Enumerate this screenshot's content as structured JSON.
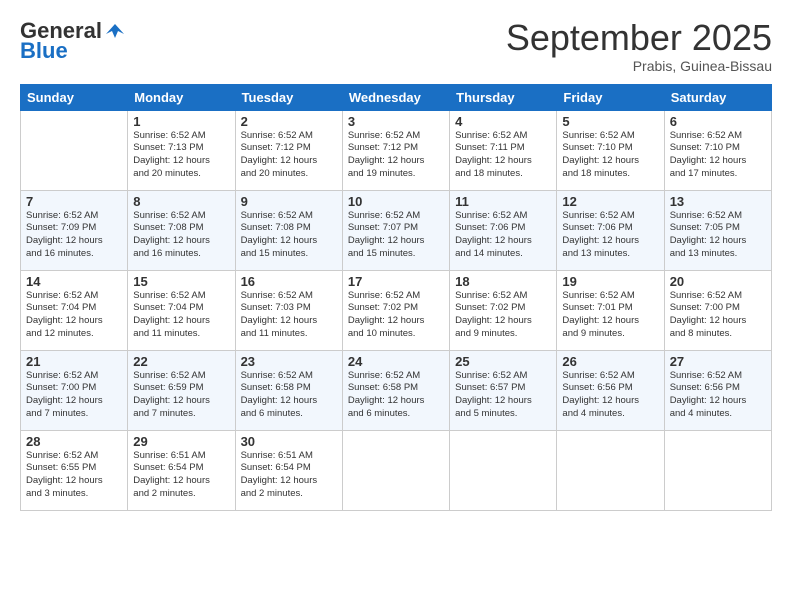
{
  "header": {
    "logo_general": "General",
    "logo_blue": "Blue",
    "month": "September 2025",
    "location": "Prabis, Guinea-Bissau"
  },
  "columns": [
    "Sunday",
    "Monday",
    "Tuesday",
    "Wednesday",
    "Thursday",
    "Friday",
    "Saturday"
  ],
  "weeks": [
    [
      {
        "day": "",
        "info": ""
      },
      {
        "day": "1",
        "info": "Sunrise: 6:52 AM\nSunset: 7:13 PM\nDaylight: 12 hours\nand 20 minutes."
      },
      {
        "day": "2",
        "info": "Sunrise: 6:52 AM\nSunset: 7:12 PM\nDaylight: 12 hours\nand 20 minutes."
      },
      {
        "day": "3",
        "info": "Sunrise: 6:52 AM\nSunset: 7:12 PM\nDaylight: 12 hours\nand 19 minutes."
      },
      {
        "day": "4",
        "info": "Sunrise: 6:52 AM\nSunset: 7:11 PM\nDaylight: 12 hours\nand 18 minutes."
      },
      {
        "day": "5",
        "info": "Sunrise: 6:52 AM\nSunset: 7:10 PM\nDaylight: 12 hours\nand 18 minutes."
      },
      {
        "day": "6",
        "info": "Sunrise: 6:52 AM\nSunset: 7:10 PM\nDaylight: 12 hours\nand 17 minutes."
      }
    ],
    [
      {
        "day": "7",
        "info": "Sunrise: 6:52 AM\nSunset: 7:09 PM\nDaylight: 12 hours\nand 16 minutes."
      },
      {
        "day": "8",
        "info": "Sunrise: 6:52 AM\nSunset: 7:08 PM\nDaylight: 12 hours\nand 16 minutes."
      },
      {
        "day": "9",
        "info": "Sunrise: 6:52 AM\nSunset: 7:08 PM\nDaylight: 12 hours\nand 15 minutes."
      },
      {
        "day": "10",
        "info": "Sunrise: 6:52 AM\nSunset: 7:07 PM\nDaylight: 12 hours\nand 15 minutes."
      },
      {
        "day": "11",
        "info": "Sunrise: 6:52 AM\nSunset: 7:06 PM\nDaylight: 12 hours\nand 14 minutes."
      },
      {
        "day": "12",
        "info": "Sunrise: 6:52 AM\nSunset: 7:06 PM\nDaylight: 12 hours\nand 13 minutes."
      },
      {
        "day": "13",
        "info": "Sunrise: 6:52 AM\nSunset: 7:05 PM\nDaylight: 12 hours\nand 13 minutes."
      }
    ],
    [
      {
        "day": "14",
        "info": "Sunrise: 6:52 AM\nSunset: 7:04 PM\nDaylight: 12 hours\nand 12 minutes."
      },
      {
        "day": "15",
        "info": "Sunrise: 6:52 AM\nSunset: 7:04 PM\nDaylight: 12 hours\nand 11 minutes."
      },
      {
        "day": "16",
        "info": "Sunrise: 6:52 AM\nSunset: 7:03 PM\nDaylight: 12 hours\nand 11 minutes."
      },
      {
        "day": "17",
        "info": "Sunrise: 6:52 AM\nSunset: 7:02 PM\nDaylight: 12 hours\nand 10 minutes."
      },
      {
        "day": "18",
        "info": "Sunrise: 6:52 AM\nSunset: 7:02 PM\nDaylight: 12 hours\nand 9 minutes."
      },
      {
        "day": "19",
        "info": "Sunrise: 6:52 AM\nSunset: 7:01 PM\nDaylight: 12 hours\nand 9 minutes."
      },
      {
        "day": "20",
        "info": "Sunrise: 6:52 AM\nSunset: 7:00 PM\nDaylight: 12 hours\nand 8 minutes."
      }
    ],
    [
      {
        "day": "21",
        "info": "Sunrise: 6:52 AM\nSunset: 7:00 PM\nDaylight: 12 hours\nand 7 minutes."
      },
      {
        "day": "22",
        "info": "Sunrise: 6:52 AM\nSunset: 6:59 PM\nDaylight: 12 hours\nand 7 minutes."
      },
      {
        "day": "23",
        "info": "Sunrise: 6:52 AM\nSunset: 6:58 PM\nDaylight: 12 hours\nand 6 minutes."
      },
      {
        "day": "24",
        "info": "Sunrise: 6:52 AM\nSunset: 6:58 PM\nDaylight: 12 hours\nand 6 minutes."
      },
      {
        "day": "25",
        "info": "Sunrise: 6:52 AM\nSunset: 6:57 PM\nDaylight: 12 hours\nand 5 minutes."
      },
      {
        "day": "26",
        "info": "Sunrise: 6:52 AM\nSunset: 6:56 PM\nDaylight: 12 hours\nand 4 minutes."
      },
      {
        "day": "27",
        "info": "Sunrise: 6:52 AM\nSunset: 6:56 PM\nDaylight: 12 hours\nand 4 minutes."
      }
    ],
    [
      {
        "day": "28",
        "info": "Sunrise: 6:52 AM\nSunset: 6:55 PM\nDaylight: 12 hours\nand 3 minutes."
      },
      {
        "day": "29",
        "info": "Sunrise: 6:51 AM\nSunset: 6:54 PM\nDaylight: 12 hours\nand 2 minutes."
      },
      {
        "day": "30",
        "info": "Sunrise: 6:51 AM\nSunset: 6:54 PM\nDaylight: 12 hours\nand 2 minutes."
      },
      {
        "day": "",
        "info": ""
      },
      {
        "day": "",
        "info": ""
      },
      {
        "day": "",
        "info": ""
      },
      {
        "day": "",
        "info": ""
      }
    ]
  ]
}
